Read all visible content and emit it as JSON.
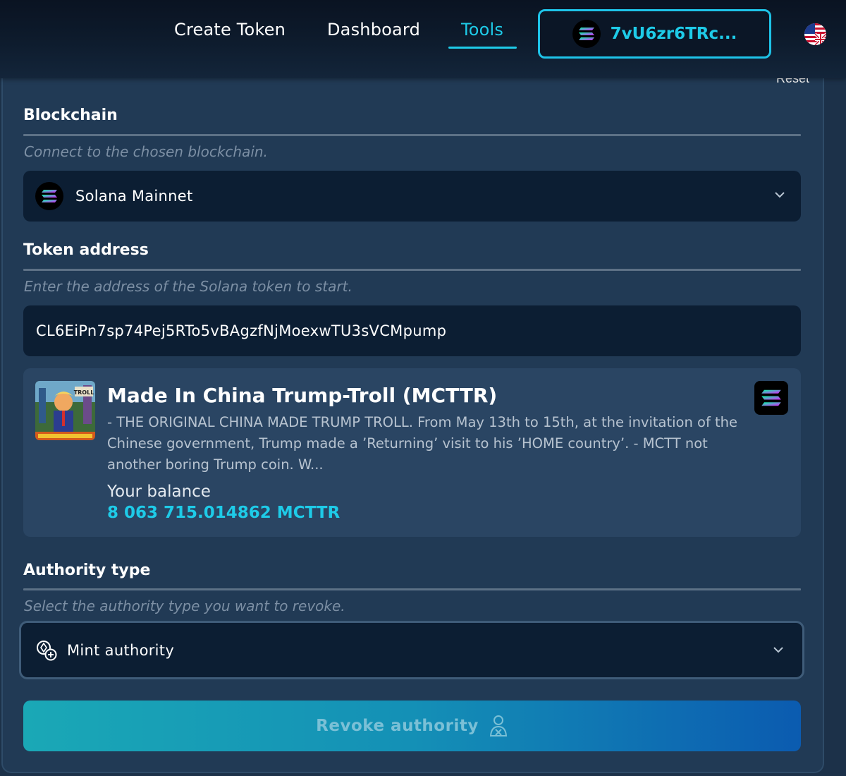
{
  "nav": {
    "links": [
      "Create Token",
      "Dashboard",
      "Tools"
    ],
    "active": "Tools",
    "wallet_address": "7vU6zr6TRc...",
    "language_icon": "us-uk-flag-icon"
  },
  "panel": {
    "reset_label": "Reset",
    "blockchain": {
      "title": "Blockchain",
      "hint": "Connect to the chosen blockchain.",
      "selected": "Solana Mainnet"
    },
    "token_address": {
      "title": "Token address",
      "hint": "Enter the address of the Solana token to start.",
      "value": "CL6EiPn7sp74Pej5RTo5vBAgzfNjMoexwTU3sVCMpump"
    },
    "token_card": {
      "name": "Made In China Trump-Troll (MCTTR)",
      "description": "- THE ORIGINAL CHINA MADE TRUMP TROLL. From May 13th to 15th, at the invitation of the Chinese government, Trump made a ’Returning’ visit to his ’HOME country’. - MCTT not another boring Trump coin. W...",
      "balance_label": "Your balance",
      "balance_value": "8 063 715.014862 MCTTR",
      "image_text": "TROLL"
    },
    "authority": {
      "title": "Authority type",
      "hint": "Select the authority type you want to revoke.",
      "selected": "Mint authority"
    },
    "revoke_button": "Revoke authority"
  },
  "colors": {
    "accent": "#1ecbe8",
    "panel_bg": "#213a55",
    "field_bg": "#0c1e33",
    "card_bg": "#2a4563"
  }
}
